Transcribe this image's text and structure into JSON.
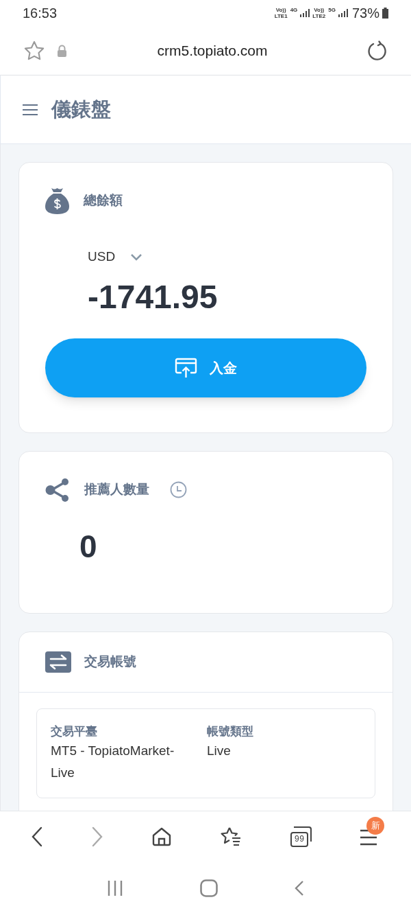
{
  "status_bar": {
    "time": "16:53",
    "indicators": [
      {
        "kind": "volte",
        "lines": [
          "Vo))",
          "LTE1"
        ]
      },
      {
        "kind": "net",
        "label": "4G"
      },
      {
        "kind": "volte",
        "lines": [
          "Vo))",
          "LTE2"
        ]
      },
      {
        "kind": "net5g",
        "label": "5G"
      }
    ],
    "battery": "73%"
  },
  "address_bar": {
    "url": "crm5.topiato.com"
  },
  "page_header": {
    "title": "儀錶盤"
  },
  "balance_card": {
    "title": "總餘額",
    "currency": "USD",
    "amount": "-1741.95",
    "deposit_button": "入金"
  },
  "referral_card": {
    "title": "推薦人數量",
    "count": "0"
  },
  "accounts_card": {
    "title": "交易帳號",
    "accounts": [
      {
        "platform_label": "交易平臺",
        "platform": "MT5 - TopiatoMarket-Live",
        "type_label": "帳號類型",
        "type": "Live"
      }
    ]
  },
  "browser_toolbar": {
    "forward_disabled": true,
    "tabs_count": "99",
    "menu_badge": "新"
  }
}
